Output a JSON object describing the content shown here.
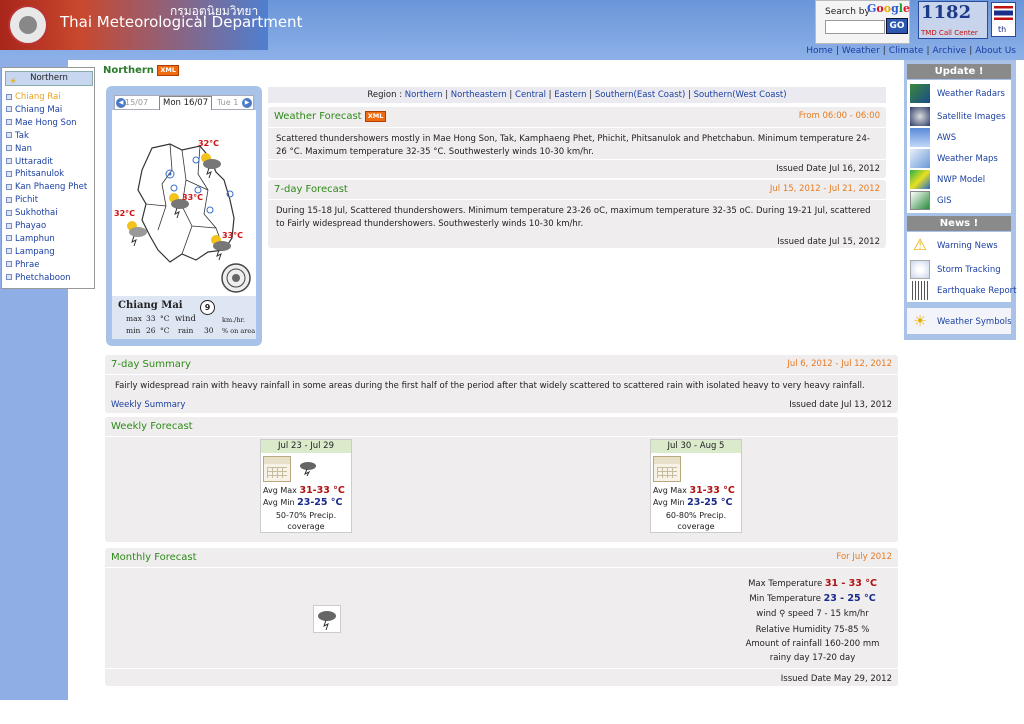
{
  "header": {
    "dept_thai": "กรมอุตุนิยมวิทยา",
    "dept_en": "Thai Meteorological Department",
    "search_label": "Search by",
    "google_letters": [
      "G",
      "o",
      "o",
      "g",
      "l",
      "e"
    ],
    "search_go": "GO",
    "callcenter_number": "1182",
    "callcenter_label": "TMD Call Center",
    "lang": "th"
  },
  "topnav": [
    "Home",
    "Weather",
    "Climate",
    "Archive",
    "About Us"
  ],
  "left_menu": {
    "heading": "Northern",
    "items": [
      "Chiang Rai",
      "Chiang Mai",
      "Mae Hong Son",
      "Tak",
      "Nan",
      "Uttaradit",
      "Phitsanulok",
      "Kan Phaeng Phet",
      "Pichit",
      "Sukhothai",
      "Phayao",
      "Lamphun",
      "Lampang",
      "Phrae",
      "Phetchaboon"
    ],
    "active_index": 0
  },
  "page": {
    "title": "Northern",
    "xml": "XML"
  },
  "map": {
    "date_prev": "15/07",
    "date_current": "Mon 16/07",
    "date_next": "Tue 1",
    "temps": [
      "32°C",
      "33°C",
      "32°C",
      "33°C"
    ],
    "station": {
      "name": "Chiang Mai",
      "max_label": "max",
      "max_value": "33",
      "min_label": "min",
      "min_value": "26",
      "unit_c": "°C",
      "wind_label": "wind",
      "wind_value": "9",
      "wind_unit": "km./hr.",
      "rain_label": "rain",
      "rain_value": "30",
      "rain_unit": "% on area"
    }
  },
  "region": {
    "label": "Region :",
    "links": [
      "Northern",
      "Northeastern",
      "Central",
      "Eastern",
      "Southern(East Coast)",
      "Southern(West Coast)"
    ]
  },
  "weather_forecast": {
    "title": "Weather Forecast",
    "xml": "XML",
    "period": "From 06:00 - 06:00",
    "text": "Scattered thundershowers mostly in Mae Hong Son, Tak, Kamphaeng Phet, Phichit, Phitsanulok and Phetchabun. Minimum temperature 24-26 °C. Maximum temperature 32-35 °C. Southwesterly winds 10-30 km/hr.",
    "issued": "Issued Date Jul 16, 2012"
  },
  "seven_day_forecast": {
    "title": "7-day Forecast",
    "period": "Jul 15, 2012 - Jul 21, 2012",
    "text": "During 15-18 Jul, Scattered thundershowers. Minimum temperature 23-26 oC, maximum temperature 32-35 oC. During 19-21 Jul, scattered to Fairly widespread thundershowers. Southwesterly winds 10-30 km/hr.",
    "issued": "Issued date Jul 15, 2012"
  },
  "seven_day_summary": {
    "title": "7-day Summary",
    "period": "Jul 6, 2012 - Jul 12, 2012",
    "text": "Fairly widespread rain with heavy rainfall in some areas during the first half of the period after that widely scattered to scattered rain with isolated heavy to very heavy rainfall.",
    "link": "Weekly Summary",
    "issued": "Issued date Jul 13, 2012"
  },
  "weekly_forecast": {
    "title": "Weekly Forecast",
    "cards": [
      {
        "range": "Jul 23 - Jul 29",
        "max_label": "Avg Max",
        "max_value": "31-33 °C",
        "min_label": "Avg Min",
        "min_value": "23-25 °C",
        "precip": "50-70% Precip.",
        "coverage": "coverage"
      },
      {
        "range": "Jul 30 - Aug 5",
        "max_label": "Avg Max",
        "max_value": "31-33 °C",
        "min_label": "Avg Min",
        "min_value": "23-25 °C",
        "precip": "60-80% Precip.",
        "coverage": "coverage"
      }
    ]
  },
  "monthly_forecast": {
    "title": "Monthly Forecast",
    "period": "For July 2012",
    "max_label": "Max Temperature",
    "max_value": "31 - 33 °C",
    "min_label": "Min Temperature",
    "min_value": "23 - 25 °C",
    "wind": "wind",
    "speed": "speed 7 - 15 km/hr",
    "humidity": "Relative Humidity 75-85 %",
    "rainfall": "Amount of rainfall 160-200 mm",
    "rainy": "rainy day 17-20 day",
    "issued": "Issued Date May 29, 2012"
  },
  "right_col": {
    "update_heading": "Update !",
    "update_items": [
      "Weather Radars",
      "Satellite Images",
      "AWS",
      "Weather Maps",
      "NWP Model",
      "GIS"
    ],
    "news_heading": "News !",
    "news_items": [
      "Warning News",
      "Storm Tracking",
      "Earthquake Report"
    ],
    "symbols": "Weather Symbols"
  }
}
